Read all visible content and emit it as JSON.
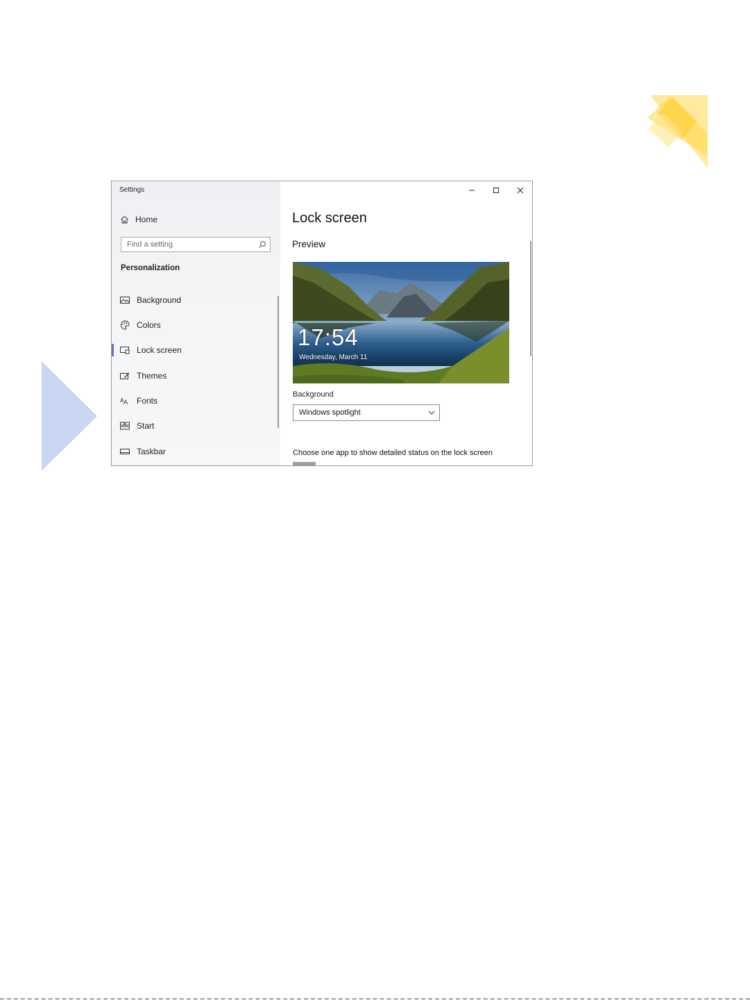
{
  "window": {
    "app_title": "Settings",
    "controls": {
      "minimize": "minimize-icon",
      "maximize": "maximize-icon",
      "close": "close-icon"
    }
  },
  "sidebar": {
    "home_label": "Home",
    "home_icon": "home-icon",
    "search_placeholder": "Find a setting",
    "search_icon": "search-icon",
    "section_heading": "Personalization",
    "items": [
      {
        "label": "Background",
        "icon": "picture-icon",
        "selected": false
      },
      {
        "label": "Colors",
        "icon": "palette-icon",
        "selected": false
      },
      {
        "label": "Lock screen",
        "icon": "lock-screen-icon",
        "selected": true
      },
      {
        "label": "Themes",
        "icon": "themes-icon",
        "selected": false
      },
      {
        "label": "Fonts",
        "icon": "fonts-icon",
        "selected": false
      },
      {
        "label": "Start",
        "icon": "start-icon",
        "selected": false
      },
      {
        "label": "Taskbar",
        "icon": "taskbar-icon",
        "selected": false
      }
    ]
  },
  "main": {
    "title": "Lock screen",
    "preview_heading": "Preview",
    "preview": {
      "time": "17:54",
      "date": "Wednesday, March 11"
    },
    "background_label": "Background",
    "background_value": "Windows spotlight",
    "status_text": "Choose one app to show detailed status on the lock screen"
  },
  "colors": {
    "accent": "#6b69d6",
    "decor_yellow": "#ffd84a",
    "decor_blue": "#c9d7f2"
  }
}
